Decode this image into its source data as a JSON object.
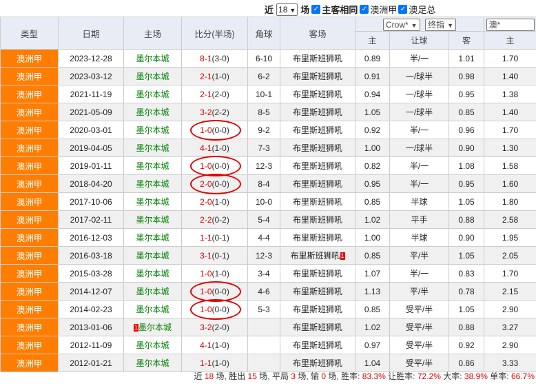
{
  "topbar": {
    "recent_label": "近",
    "recent_count": "18",
    "games_label": "场",
    "same_home_away": "主客相同",
    "filter_league": "澳洲甲",
    "filter_cup": "澳足总"
  },
  "columns": [
    "类型",
    "日期",
    "主场",
    "比分(半场)",
    "角球",
    "客场"
  ],
  "odds_header": {
    "company_select": "Crow*",
    "odds_type_select": "终指",
    "second_company_select": "澳*",
    "sub_home": "主",
    "sub_handicap": "让球",
    "sub_away": "客",
    "sub_home2": "主"
  },
  "rows": [
    {
      "type": "澳洲甲",
      "date": "2023-12-28",
      "home": "墨尔本城",
      "ft": "8-1",
      "ht": "(3-0)",
      "corner": "6-10",
      "away": "布里斯班狮吼",
      "o_home": "0.89",
      "hcap": "半/一",
      "o_away": "1.01",
      "o_home2": "1.70"
    },
    {
      "type": "澳洲甲",
      "date": "2023-03-12",
      "home": "墨尔本城",
      "ft": "2-1",
      "ht": "(1-0)",
      "corner": "6-2",
      "away": "布里斯班狮吼",
      "o_home": "0.91",
      "hcap": "一/球半",
      "o_away": "0.98",
      "o_home2": "1.40"
    },
    {
      "type": "澳洲甲",
      "date": "2021-11-19",
      "home": "墨尔本城",
      "ft": "2-1",
      "ht": "(2-0)",
      "corner": "10-1",
      "away": "布里斯班狮吼",
      "o_home": "0.94",
      "hcap": "一/球半",
      "o_away": "0.95",
      "o_home2": "1.38"
    },
    {
      "type": "澳洲甲",
      "date": "2021-05-09",
      "home": "墨尔本城",
      "ft": "3-2",
      "ht": "(2-2)",
      "corner": "8-5",
      "away": "布里斯班狮吼",
      "o_home": "1.05",
      "hcap": "一/球半",
      "o_away": "0.85",
      "o_home2": "1.40"
    },
    {
      "type": "澳洲甲",
      "date": "2020-03-01",
      "home": "墨尔本城",
      "ft": "1-0",
      "ht": "(0-0)",
      "corner": "9-2",
      "away": "布里斯班狮吼",
      "o_home": "0.92",
      "hcap": "半/一",
      "o_away": "0.96",
      "o_home2": "1.70"
    },
    {
      "type": "澳洲甲",
      "date": "2019-04-05",
      "home": "墨尔本城",
      "ft": "4-1",
      "ht": "(1-0)",
      "corner": "7-3",
      "away": "布里斯班狮吼",
      "o_home": "1.00",
      "hcap": "一/球半",
      "o_away": "0.90",
      "o_home2": "1.30"
    },
    {
      "type": "澳洲甲",
      "date": "2019-01-11",
      "home": "墨尔本城",
      "ft": "1-0",
      "ht": "(0-0)",
      "corner": "12-3",
      "away": "布里斯班狮吼",
      "o_home": "0.82",
      "hcap": "半/一",
      "o_away": "1.08",
      "o_home2": "1.58"
    },
    {
      "type": "澳洲甲",
      "date": "2018-04-20",
      "home": "墨尔本城",
      "ft": "2-0",
      "ht": "(0-0)",
      "corner": "8-4",
      "away": "布里斯班狮吼",
      "o_home": "0.95",
      "hcap": "半/一",
      "o_away": "0.95",
      "o_home2": "1.60"
    },
    {
      "type": "澳洲甲",
      "date": "2017-10-06",
      "home": "墨尔本城",
      "ft": "2-0",
      "ht": "(1-0)",
      "corner": "10-0",
      "away": "布里斯班狮吼",
      "o_home": "0.85",
      "hcap": "半球",
      "o_away": "1.05",
      "o_home2": "1.80"
    },
    {
      "type": "澳洲甲",
      "date": "2017-02-11",
      "home": "墨尔本城",
      "ft": "2-2",
      "ht": "(0-2)",
      "corner": "5-4",
      "away": "布里斯班狮吼",
      "o_home": "1.02",
      "hcap": "平手",
      "o_away": "0.88",
      "o_home2": "2.58"
    },
    {
      "type": "澳洲甲",
      "date": "2016-12-03",
      "home": "墨尔本城",
      "ft": "1-1",
      "ht": "(0-1)",
      "corner": "4-4",
      "away": "布里斯班狮吼",
      "o_home": "1.00",
      "hcap": "半球",
      "o_away": "0.90",
      "o_home2": "1.95"
    },
    {
      "type": "澳洲甲",
      "date": "2016-03-18",
      "home": "墨尔本城",
      "ft": "3-1",
      "ht": "(0-1)",
      "corner": "12-3",
      "away": "布里斯班狮吼",
      "away_tag": "1",
      "o_home": "0.85",
      "hcap": "平/半",
      "o_away": "1.05",
      "o_home2": "2.05"
    },
    {
      "type": "澳洲甲",
      "date": "2015-03-28",
      "home": "墨尔本城",
      "ft": "1-0",
      "ht": "(1-0)",
      "corner": "3-4",
      "away": "布里斯班狮吼",
      "o_home": "1.07",
      "hcap": "半/一",
      "o_away": "0.83",
      "o_home2": "1.70"
    },
    {
      "type": "澳洲甲",
      "date": "2014-12-07",
      "home": "墨尔本城",
      "ft": "1-0",
      "ht": "(0-0)",
      "corner": "4-6",
      "away": "布里斯班狮吼",
      "o_home": "1.13",
      "hcap": "平/半",
      "o_away": "0.78",
      "o_home2": "2.15"
    },
    {
      "type": "澳洲甲",
      "date": "2014-02-23",
      "home": "墨尔本城",
      "ft": "1-0",
      "ht": "(0-0)",
      "corner": "5-3",
      "away": "布里斯班狮吼",
      "o_home": "0.85",
      "hcap": "受平/半",
      "o_away": "1.05",
      "o_home2": "2.90"
    },
    {
      "type": "澳洲甲",
      "date": "2013-01-06",
      "home": "墨尔本城",
      "home_tag": "1",
      "ft": "3-2",
      "ht": "(2-0)",
      "corner": "",
      "away": "布里斯班狮吼",
      "o_home": "1.02",
      "hcap": "受平/半",
      "o_away": "0.88",
      "o_home2": "3.27"
    },
    {
      "type": "澳洲甲",
      "date": "2012-11-09",
      "home": "墨尔本城",
      "ft": "4-1",
      "ht": "(1-0)",
      "corner": "",
      "away": "布里斯班狮吼",
      "o_home": "0.97",
      "hcap": "受平/半",
      "o_away": "0.92",
      "o_home2": "2.90"
    },
    {
      "type": "澳洲甲",
      "date": "2012-01-21",
      "home": "墨尔本城",
      "ft": "1-1",
      "ht": "(1-0)",
      "corner": "",
      "away": "布里斯班狮吼",
      "o_home": "1.04",
      "hcap": "受平/半",
      "o_away": "0.86",
      "o_home2": "3.33"
    }
  ],
  "summary": {
    "recent": "近",
    "total": "18",
    "total_unit": "场,",
    "won_label": "胜出",
    "won": "15",
    "won_unit": "场,",
    "draw_label": "平局",
    "draw": "3",
    "draw_unit": "场,",
    "lost_label": "输",
    "lost": "0",
    "lost_unit": "场,",
    "win_rate_label": "胜率:",
    "win_rate": "83.3%",
    "cover_rate_label": "让胜率:",
    "cover_rate": "72.2%",
    "over_rate_label": "大率:",
    "over_rate": "38.9%",
    "odd_rate_label": "单率:",
    "odd_rate": "66.7%"
  },
  "annotations": {
    "circle_color": "#e00000",
    "circled_rows": [
      4,
      6,
      7,
      13,
      14
    ]
  },
  "colors": {
    "type_cell": "#ff7d00",
    "header_bg": "#e8edf5",
    "home_team": "#008000",
    "score": "#dd0000",
    "checkbox": "#0075ff"
  }
}
